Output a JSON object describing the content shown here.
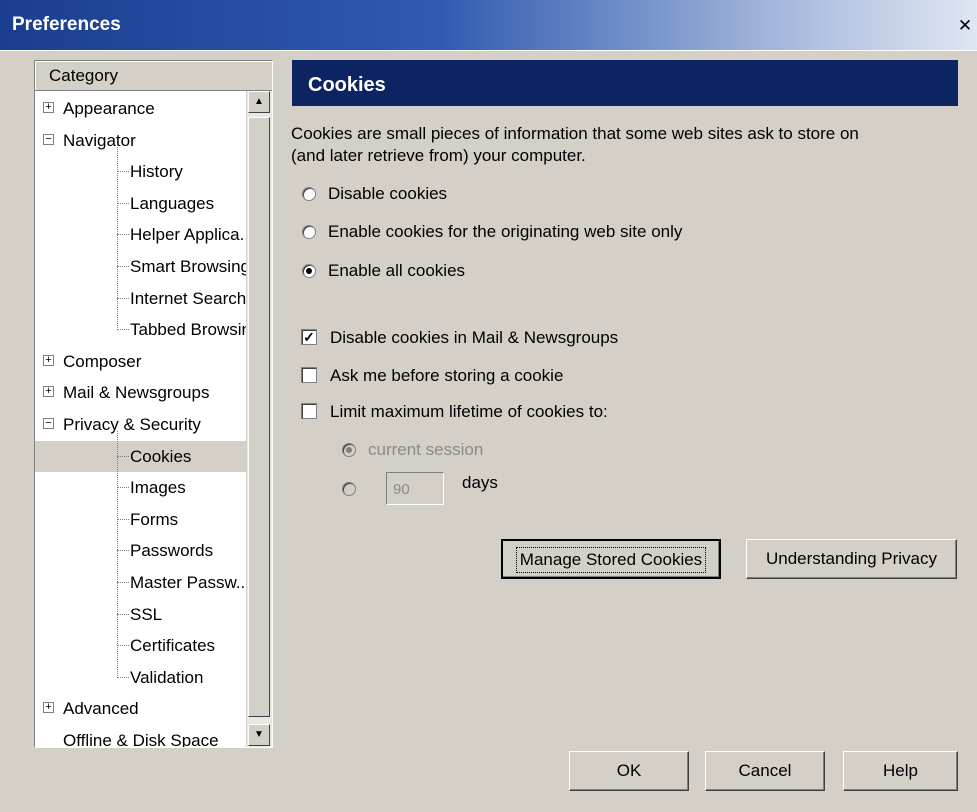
{
  "window": {
    "title": "Preferences",
    "close_glyph": "✕"
  },
  "category": {
    "header": "Category",
    "items": [
      {
        "label": "Appearance",
        "expander": "+"
      },
      {
        "label": "Navigator",
        "expander": "−"
      },
      {
        "label": "History"
      },
      {
        "label": "Languages"
      },
      {
        "label": "Helper Applica..."
      },
      {
        "label": "Smart Browsing"
      },
      {
        "label": "Internet Search"
      },
      {
        "label": "Tabbed Browsing"
      },
      {
        "label": "Composer",
        "expander": "+"
      },
      {
        "label": "Mail & Newsgroups",
        "expander": "+"
      },
      {
        "label": "Privacy & Security",
        "expander": "−"
      },
      {
        "label": "Cookies",
        "selected": true
      },
      {
        "label": "Images"
      },
      {
        "label": "Forms"
      },
      {
        "label": "Passwords"
      },
      {
        "label": "Master Passw..."
      },
      {
        "label": "SSL"
      },
      {
        "label": "Certificates"
      },
      {
        "label": "Validation"
      },
      {
        "label": "Advanced",
        "expander": "+"
      },
      {
        "label": "Offline & Disk Space"
      }
    ]
  },
  "panel": {
    "title": "Cookies",
    "description_line1": "Cookies are small pieces of information that some web sites ask to store on",
    "description_line2": "(and later retrieve from) your computer.",
    "radio_disable": "Disable cookies",
    "radio_originating": "Enable cookies for the originating web site only",
    "radio_all": "Enable all cookies",
    "selected_policy": "Enable all cookies",
    "check_mail": "Disable cookies in Mail & Newsgroups",
    "check_mail_checked": true,
    "check_ask": "Ask me before storing a cookie",
    "check_ask_checked": false,
    "check_limit": "Limit maximum lifetime of cookies to:",
    "check_limit_checked": false,
    "lifetime_session": "current session",
    "lifetime_days_value": "90",
    "lifetime_days_label": "days",
    "manage_button": "Manage Stored Cookies",
    "privacy_button": "Understanding Privacy"
  },
  "footer": {
    "ok": "OK",
    "cancel": "Cancel",
    "help": "Help"
  },
  "colors": {
    "panel_header": "#0c2461",
    "window_bg": "#d4d0c8"
  }
}
